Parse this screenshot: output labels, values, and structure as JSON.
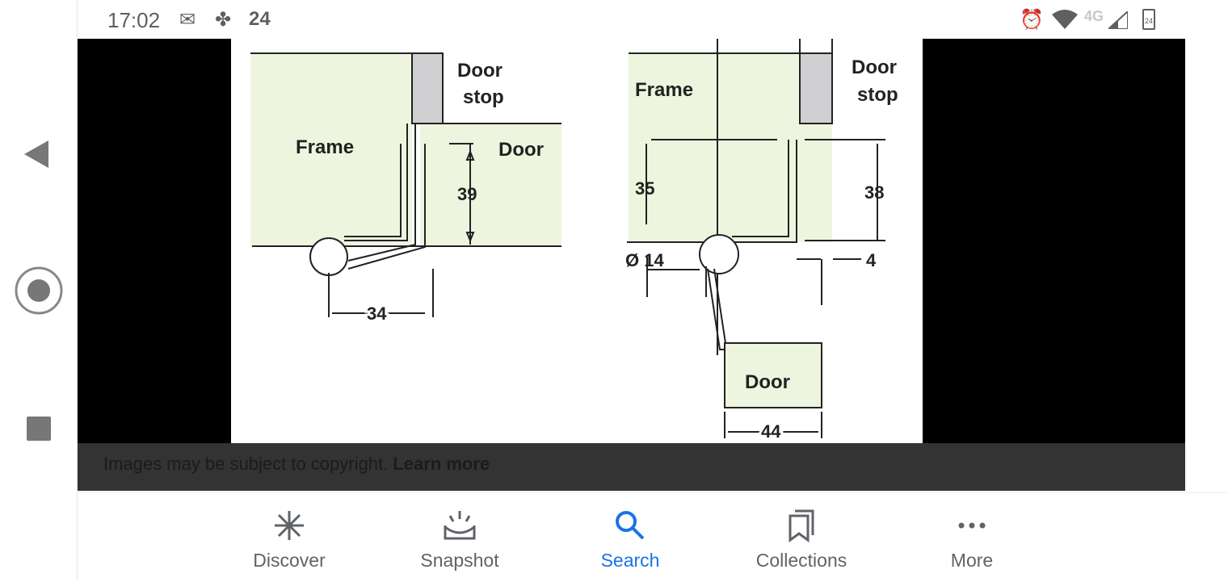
{
  "status_bar": {
    "time": "17:02",
    "notification_count": "24",
    "icons": [
      "outlook-icon",
      "pinwheel-icon",
      "alarm-icon",
      "wifi-icon",
      "signal-icon",
      "battery-icon"
    ],
    "network": "4G",
    "battery": "24"
  },
  "diagram": {
    "left": {
      "frame": "Frame",
      "door_stop_1": "Door",
      "door_stop_2": "stop",
      "door": "Door",
      "dim_height": "39",
      "dim_width": "34"
    },
    "right": {
      "frame": "Frame",
      "door_stop_1": "Door",
      "door_stop_2": "stop",
      "door": "Door",
      "dim_left_height": "35",
      "dim_right_height": "38",
      "dim_diameter": "Ø 14",
      "dim_gap": "4",
      "dim_width": "44"
    }
  },
  "copyright": {
    "text": "Images may be subject to copyright. ",
    "link": "Learn more"
  },
  "bottom_nav": [
    {
      "label": "Discover"
    },
    {
      "label": "Snapshot"
    },
    {
      "label": "Search",
      "active": true
    },
    {
      "label": "Collections"
    },
    {
      "label": "More"
    }
  ],
  "colors": {
    "accent": "#1a73e8",
    "frame_fill": "#eef5df",
    "stop_fill": "#d0d0d2"
  }
}
